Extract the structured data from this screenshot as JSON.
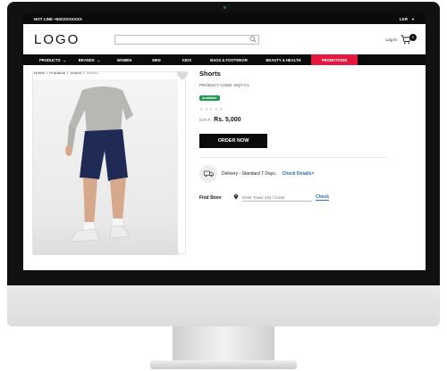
{
  "topbar": {
    "hotline": "HOT LINE +94XXXXXXXX",
    "currency": "LKR"
  },
  "header": {
    "logo": "LOGO",
    "login": "Log In",
    "cart_count": "0",
    "search_placeholder": ""
  },
  "nav": {
    "items": [
      {
        "label": "PRODUCTS",
        "dropdown": true
      },
      {
        "label": "BRANDS",
        "dropdown": true
      },
      {
        "label": "WOMEN"
      },
      {
        "label": "MEN"
      },
      {
        "label": "KIDS"
      },
      {
        "label": "BAGS & FOOTWEAR"
      },
      {
        "label": "BEAUTY & HEALTH"
      },
      {
        "label": "PROMOTIONS",
        "highlight": true
      }
    ]
  },
  "breadcrumb": {
    "items": [
      "Home",
      "Products",
      "Shorts"
    ],
    "current": "Shorts",
    "sep": "/"
  },
  "product": {
    "title": "Shorts",
    "code": "PRODUCT CODE: MQT-C1",
    "badge": "Available",
    "stars": "★★★★★",
    "mrp_label": "M.R.P.",
    "price": "Rs. 5,000",
    "order_label": "ORDER NOW",
    "delivery_text": "Delivery - Standard 7 Days..",
    "delivery_link": "Check Details>",
    "find_store_label": "Find Store",
    "store_placeholder": "Enter Town/ City / Code",
    "store_check": "Check"
  },
  "colors": {
    "accent": "#e5173f",
    "badge": "#1b9b4b",
    "link": "#2a6db0"
  }
}
